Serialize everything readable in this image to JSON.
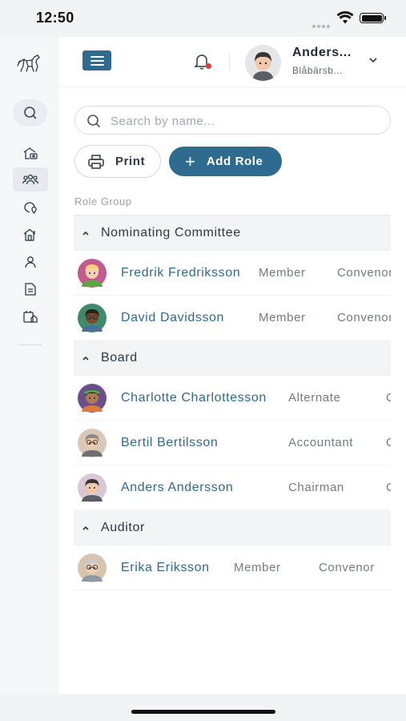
{
  "status_bar": {
    "time": "12:50"
  },
  "sidebar": {
    "items": [
      {
        "name": "sidebar-item-stable",
        "icon": "house-horse-icon",
        "active": false
      },
      {
        "name": "sidebar-item-roles",
        "icon": "people-group-icon",
        "active": true
      },
      {
        "name": "sidebar-item-pastures",
        "icon": "location-pin-icon",
        "active": false
      },
      {
        "name": "sidebar-item-facilities",
        "icon": "barn-icon",
        "active": false
      },
      {
        "name": "sidebar-item-members",
        "icon": "person-icon",
        "active": false
      },
      {
        "name": "sidebar-item-documents",
        "icon": "document-icon",
        "active": false
      },
      {
        "name": "sidebar-item-calendar",
        "icon": "calendar-house-icon",
        "active": false
      }
    ]
  },
  "header": {
    "user_name": "Anders...",
    "user_sub": "Blåbärsb..."
  },
  "search": {
    "placeholder": "Search by name..."
  },
  "toolbar": {
    "print_label": "Print",
    "add_role_label": "Add Role",
    "add_icon": "+"
  },
  "table": {
    "column_header": "Role Group",
    "groups": [
      {
        "name": "Nominating Committee",
        "people": [
          {
            "name": "Fredrik Fredriksson",
            "role": "Member",
            "extra": "Convenor",
            "avatar": "green-shirt-blond"
          },
          {
            "name": "David Davidsson",
            "role": "Member",
            "extra": "Convenor",
            "avatar": "dark-skin-glasses"
          }
        ]
      },
      {
        "name": "Board",
        "people": [
          {
            "name": "Charlotte Charlottesson",
            "role": "Alternate",
            "extra": "C",
            "avatar": "green-headband"
          },
          {
            "name": "Bertil Bertilsson",
            "role": "Accountant",
            "extra": "C",
            "avatar": "grey-glasses"
          },
          {
            "name": "Anders Andersson",
            "role": "Chairman",
            "extra": "C",
            "avatar": "dark-hair"
          }
        ]
      },
      {
        "name": "Auditor",
        "people": [
          {
            "name": "Erika Eriksson",
            "role": "Member",
            "extra": "Convenor",
            "avatar": "grey-hair-woman"
          }
        ]
      }
    ]
  }
}
